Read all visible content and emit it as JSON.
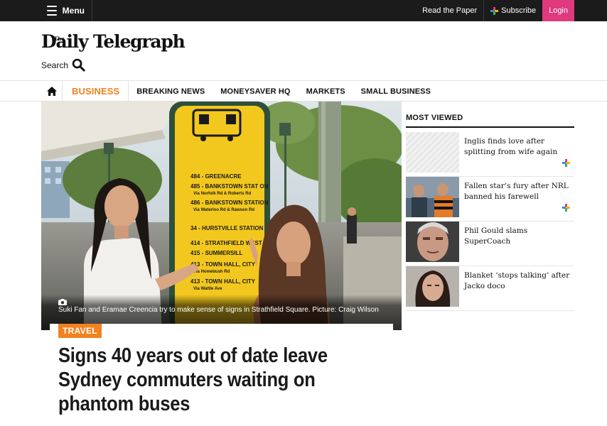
{
  "topbar": {
    "menu_label": "Menu",
    "read_paper_label": "Read the Paper",
    "subscribe_label": "Subscribe",
    "login_label": "Login",
    "colors": {
      "bar": "#1b1b1b",
      "login": "#e0397d"
    }
  },
  "masthead": {
    "logo_the": "The",
    "logo_text": "Daily Telegraph",
    "search_label": "Search"
  },
  "nav": {
    "home_icon": "home-icon",
    "items": [
      {
        "label": "BUSINESS",
        "active": true
      },
      {
        "label": "BREAKING NEWS"
      },
      {
        "label": "MONEYSAVER HQ"
      },
      {
        "label": "MARKETS"
      },
      {
        "label": "SMALL BUSINESS"
      }
    ],
    "accent": "#f0821f"
  },
  "hero": {
    "caption": "Suki Fan and Eramae Creencia try to make sense of signs in Strathfield Square. Picture: Craig Wilson",
    "sign_routes": [
      "484 - GREENACRE",
      "485 - BANKSTOWN STAT ON",
      "Via Norfolk Rd & Roberts Rd",
      "486 - BANKSTOWN STATION",
      "Via Waterloo Rd & Rawson Rd",
      "34 - HURSTVILLE STATION",
      "414 - STRATHFIELD WEST",
      "415 - SUMMERSILL",
      "413 - TOWN HALL, CITY",
      "Via Homebush Rd",
      "413 - TOWN HALL, CITY",
      "Via Wattle Ave"
    ]
  },
  "article": {
    "tag": "TRAVEL",
    "headline": "Signs 40 years out of date leave Sydney commuters waiting on phantom buses"
  },
  "most_viewed": {
    "title": "MOST VIEWED",
    "items": [
      {
        "title": "Inglis finds love after splitting from wife again",
        "premium": true
      },
      {
        "title": "Fallen star’s fury after NRL banned his farewell",
        "premium": true
      },
      {
        "title": "Phil Gould slams SuperCoach",
        "premium": false
      },
      {
        "title": "Blanket ‘stops talking’ after Jacko doco",
        "premium": false
      }
    ]
  }
}
